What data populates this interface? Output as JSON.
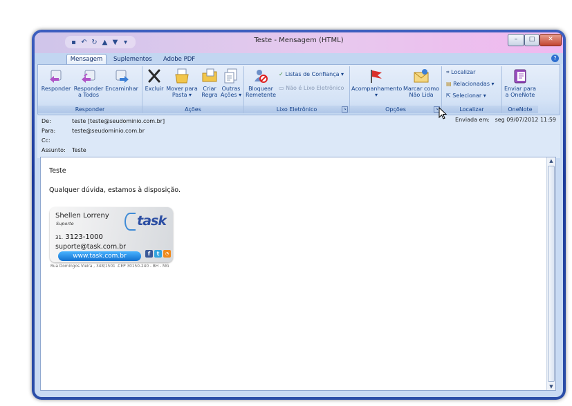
{
  "window": {
    "title": "Teste - Mensagem (HTML)",
    "controls": {
      "minimize": "–",
      "maximize": "□",
      "close": "✕"
    }
  },
  "quick_access": {
    "icons": [
      "save-icon",
      "undo-icon",
      "redo-icon",
      "up-arrow-icon",
      "down-arrow-icon",
      "customize-icon"
    ],
    "glyphs": [
      "▪",
      "↶",
      "↻",
      "▲",
      "▼",
      "▾"
    ]
  },
  "tabs": [
    {
      "label": "Mensagem",
      "active": true
    },
    {
      "label": "Suplementos",
      "active": false
    },
    {
      "label": "Adobe PDF",
      "active": false
    }
  ],
  "help": "?",
  "ribbon": {
    "responder": {
      "label": "Responder",
      "buttons": [
        "Responder",
        "Responder a Todos",
        "Encaminhar"
      ],
      "reply_all_line1": "Responder",
      "reply_all_line2": "a Todos"
    },
    "acoes": {
      "label": "Ações",
      "excluir": "Excluir",
      "mover_1": "Mover para",
      "mover_2": "Pasta ▾",
      "criar_1": "Criar",
      "criar_2": "Regra",
      "outras_1": "Outras",
      "outras_2": "Ações ▾"
    },
    "lixo": {
      "label": "Lixo Eletrônico",
      "bloquear_1": "Bloquear",
      "bloquear_2": "Remetente",
      "listas": "Listas de Confiança ▾",
      "nao_lixo": "Não é Lixo Eletrônico"
    },
    "opcoes": {
      "label": "Opções",
      "acompanhamento": "Acompanhamento",
      "acomp_arrow": "▾",
      "marcar_1": "Marcar como",
      "marcar_2": "Não Lida"
    },
    "localizar": {
      "label": "Localizar",
      "localizar": "Localizar",
      "relacionadas": "Relacionadas ▾",
      "selecionar": "Selecionar ▾"
    },
    "onenote": {
      "label": "OneNote",
      "enviar_1": "Enviar para",
      "enviar_2": "a OneNote"
    }
  },
  "header": {
    "de_label": "De:",
    "de_value": "teste [teste@seudominio.com.br]",
    "para_label": "Para:",
    "para_value": "teste@seudominio.com.br",
    "cc_label": "Cc:",
    "cc_value": "",
    "assunto_label": "Assunto:",
    "assunto_value": "Teste",
    "enviada_label": "Enviada em:",
    "enviada_value": "seg 09/07/2012 11:59"
  },
  "body": {
    "line1": "Teste",
    "line2": "Qualquer dúvida, estamos à disposição."
  },
  "signature": {
    "name": "Shellen Lorreny",
    "role": "Suporte",
    "area_code": "31.",
    "phone": "3123-1000",
    "email": "suporte@task.com.br",
    "logo": "task",
    "site": "www.task.com.br",
    "social": [
      "f",
      "t",
      "rss"
    ],
    "address": "Rua Domingos Vieira , 348/1501 .CEP 30150-240 - BH - MG"
  },
  "scrollbar": {
    "up": "▲",
    "down": "▼"
  },
  "colors": {
    "accent": "#15428b",
    "frame": "#1c3a9a",
    "link_blue": "#1170cf"
  }
}
